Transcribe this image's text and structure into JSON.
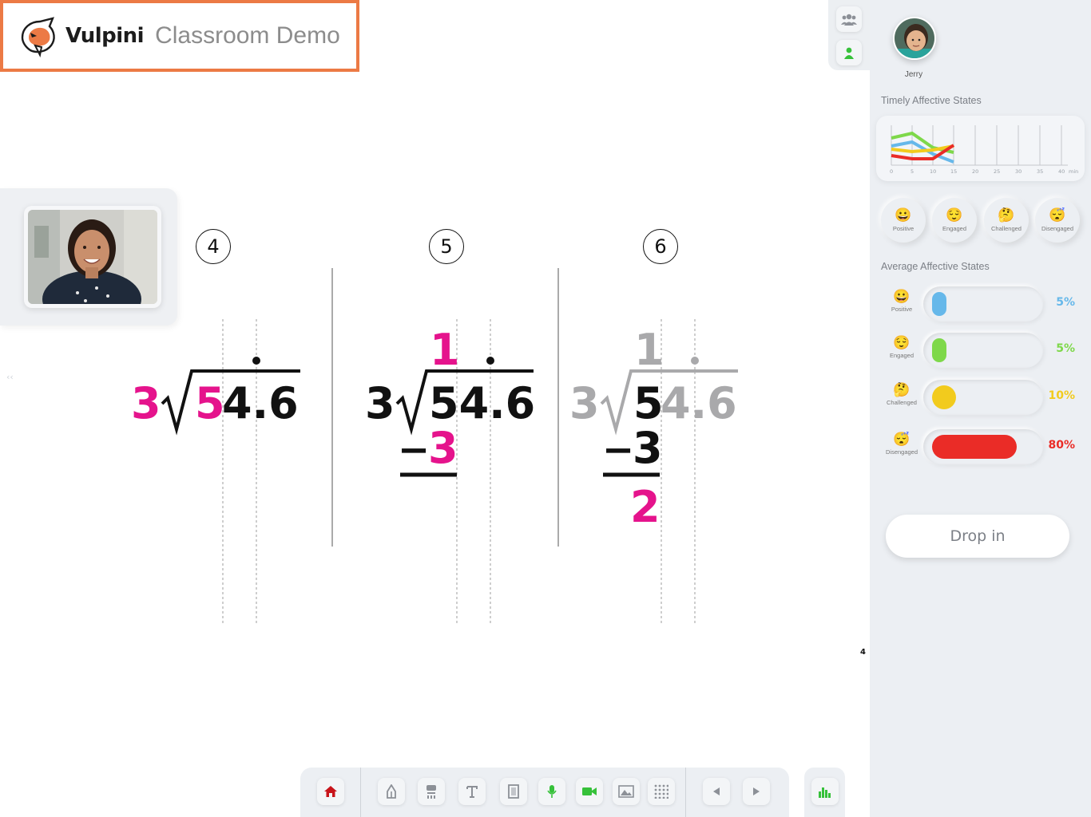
{
  "brand": {
    "name": "Vulpini",
    "subtitle": "Classroom Demo"
  },
  "board": {
    "problem_numbers": [
      "4",
      "5",
      "6"
    ],
    "page_number": "4",
    "problem4": {
      "divisor": "3",
      "first_digit": "5",
      "rest": "4.6"
    },
    "problem5": {
      "quotient": "1",
      "divisor": "3",
      "dividend": "54.6",
      "minus": "−",
      "subtrahend": "3"
    },
    "problem6": {
      "quotient": "1",
      "divisor": "3",
      "first_digit": "5",
      "rest": "4.6",
      "minus": "−",
      "subtrahend": "3",
      "remainder": "2"
    },
    "colors": {
      "highlight": "#e5138c",
      "ink": "#111111",
      "faded": "#a9a9ab"
    }
  },
  "sidebar": {
    "student": {
      "name": "Jerry"
    },
    "timely_title": "Timely Affective States",
    "chart_ticks": [
      "0",
      "5",
      "10",
      "15",
      "20",
      "25",
      "30",
      "35",
      "40"
    ],
    "chart_unit": "min",
    "emotions": [
      {
        "label": "Positive",
        "icon": "smile-face-icon"
      },
      {
        "label": "Engaged",
        "icon": "relieved-face-icon"
      },
      {
        "label": "Challenged",
        "icon": "thinking-face-icon"
      },
      {
        "label": "Disengaged",
        "icon": "sleepy-face-icon"
      }
    ],
    "average_title": "Average Affective States",
    "averages": [
      {
        "label": "Positive",
        "percent": "5%",
        "value": 5,
        "color": "#66b8ea"
      },
      {
        "label": "Engaged",
        "percent": "5%",
        "value": 5,
        "color": "#7ed84a"
      },
      {
        "label": "Challenged",
        "percent": "10%",
        "value": 10,
        "color": "#f2cb1d"
      },
      {
        "label": "Disengaged",
        "percent": "80%",
        "value": 80,
        "color": "#ea2c27"
      }
    ],
    "drop_in_label": "Drop in"
  },
  "toolbar": {
    "buttons": [
      "home-icon",
      "pen-icon",
      "eraser-icon",
      "text-icon",
      "page-icon",
      "microphone-icon",
      "video-camera-icon",
      "image-icon",
      "grid-icon",
      "previous-icon",
      "next-icon"
    ]
  },
  "colors": {
    "brand_orange": "#ec7a45",
    "active_green": "#36c13a",
    "home_red": "#c8141a"
  }
}
